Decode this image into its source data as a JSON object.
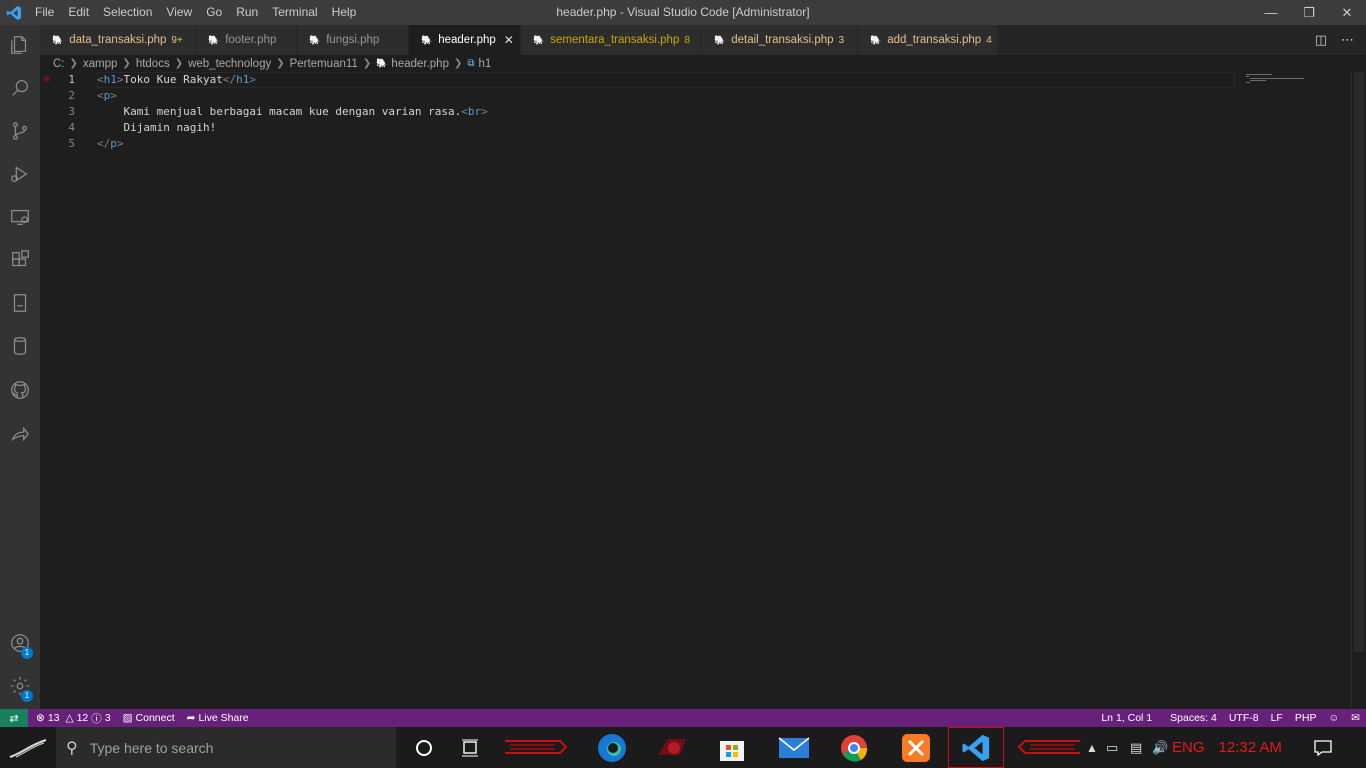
{
  "window": {
    "title": "header.php - Visual Studio Code [Administrator]",
    "menu": [
      "File",
      "Edit",
      "Selection",
      "View",
      "Go",
      "Run",
      "Terminal",
      "Help"
    ]
  },
  "tabs": [
    {
      "label": "data_transaksi.php",
      "count": "9+",
      "color": "#e2c08d",
      "active": false
    },
    {
      "label": "footer.php",
      "count": "",
      "color": "#969696",
      "active": false
    },
    {
      "label": "fungsi.php",
      "count": "",
      "color": "#969696",
      "active": false
    },
    {
      "label": "header.php",
      "count": "",
      "color": "#ffffff",
      "active": true
    },
    {
      "label": "sementara_transaksi.php",
      "count": "8",
      "color": "#cca700",
      "active": false
    },
    {
      "label": "detail_transaksi.php",
      "count": "3",
      "color": "#e2c08d",
      "active": false
    },
    {
      "label": "add_transaksi.php",
      "count": "4",
      "color": "#e2c08d",
      "active": false
    }
  ],
  "breadcrumb": [
    "C:",
    "xampp",
    "htdocs",
    "web_technology",
    "Pertemuan11",
    "header.php",
    "h1"
  ],
  "editor": {
    "lines": [
      {
        "num": "1",
        "parts": [
          {
            "t": "<",
            "c": "brk"
          },
          {
            "t": "h1",
            "c": "tag"
          },
          {
            "t": ">",
            "c": "brk"
          },
          {
            "t": "Toko Kue Rakyat",
            "c": "txt"
          },
          {
            "t": "</",
            "c": "brk"
          },
          {
            "t": "h1",
            "c": "tag"
          },
          {
            "t": ">",
            "c": "brk"
          }
        ]
      },
      {
        "num": "2",
        "parts": [
          {
            "t": "<",
            "c": "brk"
          },
          {
            "t": "p",
            "c": "tag"
          },
          {
            "t": ">",
            "c": "brk"
          }
        ]
      },
      {
        "num": "3",
        "parts": [
          {
            "t": "    Kami menjual berbagai macam kue dengan varian rasa.",
            "c": "txt"
          },
          {
            "t": "<",
            "c": "brk"
          },
          {
            "t": "br",
            "c": "tag"
          },
          {
            "t": ">",
            "c": "brk"
          }
        ]
      },
      {
        "num": "4",
        "parts": [
          {
            "t": "    Dijamin nagih!",
            "c": "txt"
          }
        ]
      },
      {
        "num": "5",
        "parts": [
          {
            "t": "</",
            "c": "brk"
          },
          {
            "t": "p",
            "c": "tag"
          },
          {
            "t": ">",
            "c": "brk"
          }
        ]
      }
    ]
  },
  "status": {
    "errors": "13",
    "warnings": "12",
    "info": "3",
    "connect": "Connect",
    "live_share": "Live Share",
    "position": "Ln 1, Col 1",
    "spaces": "Spaces: 4",
    "encoding": "UTF-8",
    "eol": "LF",
    "language": "PHP"
  },
  "activity": {
    "accounts_badge": "1",
    "settings_badge": "1"
  },
  "taskbar": {
    "search_placeholder": "Type here to search",
    "lang": "ENG",
    "time": "12:32 AM"
  }
}
